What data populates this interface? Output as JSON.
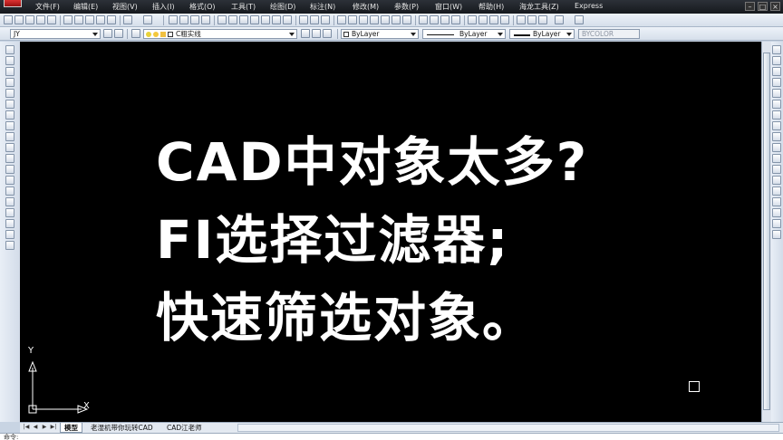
{
  "menu": {
    "items": [
      "文件(F)",
      "编辑(E)",
      "视图(V)",
      "插入(I)",
      "格式(O)",
      "工具(T)",
      "绘图(D)",
      "标注(N)",
      "修改(M)",
      "参数(P)",
      "窗口(W)",
      "帮助(H)",
      "海龙工具(Z)",
      "Express"
    ],
    "window_controls": [
      "–",
      "□",
      "×"
    ]
  },
  "toolbar_properties": {
    "textstyle_value": "JY",
    "layer_value": "C粗实线",
    "color_value": "ByLayer",
    "linetype_value": "ByLayer",
    "lineweight_value": "ByLayer",
    "plotstyle_value": "BYCOLOR"
  },
  "canvas": {
    "background": "#000000",
    "lines": [
      "CAD中对象太多?",
      "FI选择过滤器;",
      "快速筛选对象。"
    ],
    "ucs": {
      "y_label": "Y",
      "x_label": "X"
    }
  },
  "layout_tabs": {
    "nav_buttons": [
      "|◀",
      "◀",
      "▶",
      "▶|"
    ],
    "tabs": [
      "模型",
      "老湿机带你玩转CAD",
      "CAD江老师"
    ],
    "active_tab": "模型"
  },
  "command_line": {
    "prompt": "命令:"
  }
}
